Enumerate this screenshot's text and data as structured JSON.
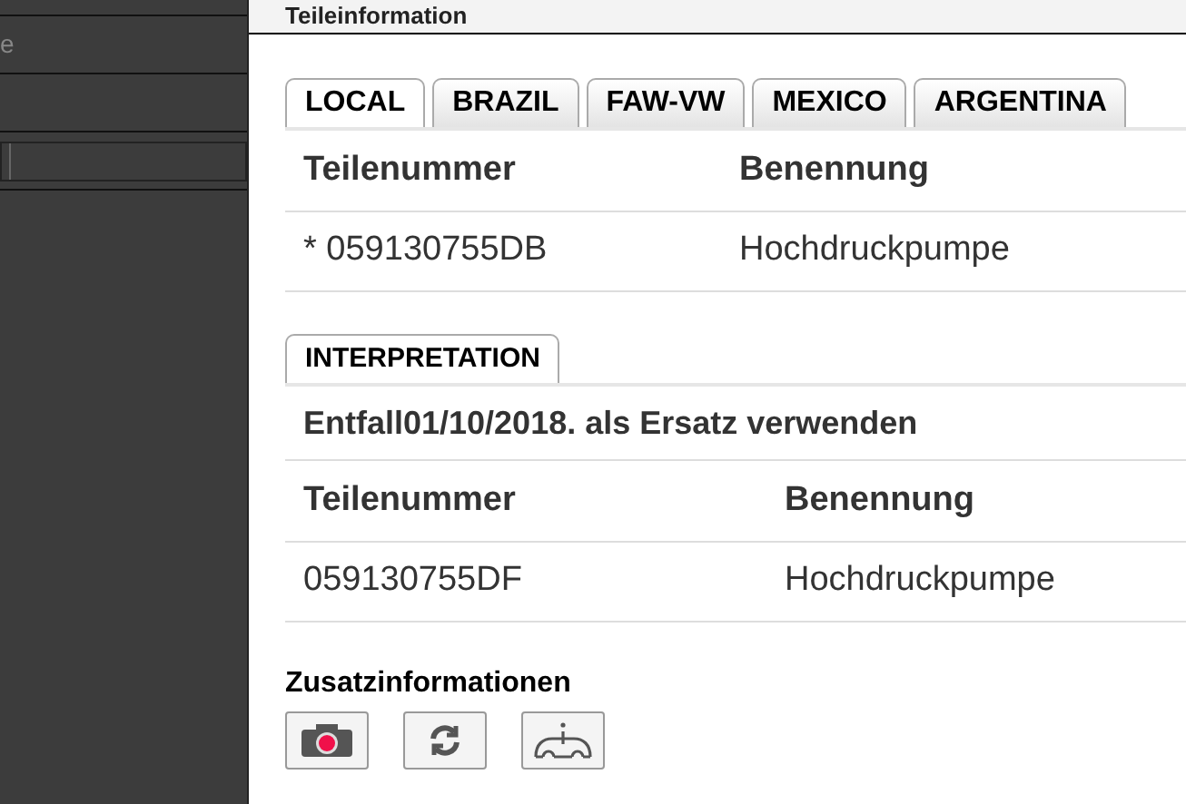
{
  "sidebar": {
    "items": [
      {
        "kind": "text",
        "label": "e"
      },
      {
        "kind": "blank"
      },
      {
        "kind": "select"
      }
    ]
  },
  "header": {
    "title": "Teileinformation"
  },
  "tabs": [
    {
      "label": "LOCAL",
      "selected": true
    },
    {
      "label": "BRAZIL",
      "selected": false
    },
    {
      "label": "FAW-VW",
      "selected": false
    },
    {
      "label": "MEXICO",
      "selected": false
    },
    {
      "label": "ARGENTINA",
      "selected": false
    }
  ],
  "parts_table": {
    "columns": [
      "Teilenummer",
      "Benennung"
    ],
    "rows": [
      [
        "* 059130755DB",
        "Hochdruckpumpe"
      ]
    ]
  },
  "interpretation": {
    "tab": "INTERPRETATION",
    "note": "Entfall01/10/2018. als Ersatz verwenden",
    "columns": [
      "Teilenummer",
      "Benennung"
    ],
    "rows": [
      [
        "059130755DF",
        "Hochdruckpumpe"
      ]
    ]
  },
  "additional": {
    "title": "Zusatzinformationen",
    "buttons": [
      {
        "kind": "camera"
      },
      {
        "kind": "refresh"
      },
      {
        "kind": "info"
      }
    ]
  }
}
